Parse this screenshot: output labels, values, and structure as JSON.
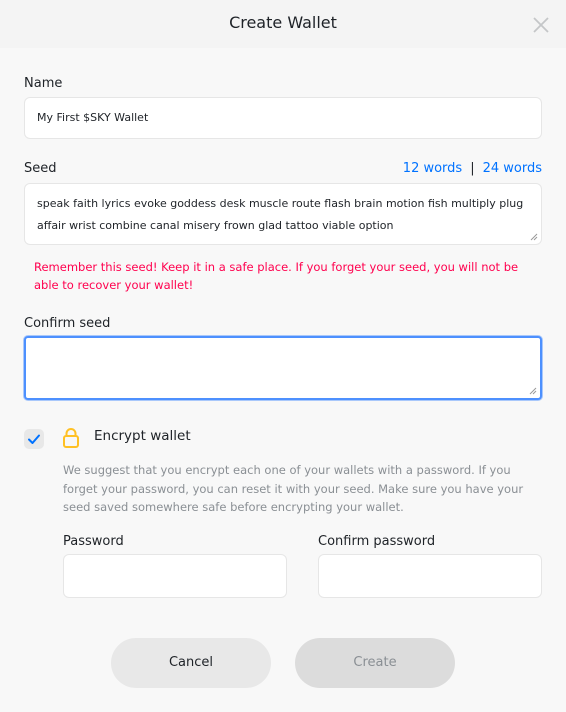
{
  "dialog": {
    "title": "Create Wallet",
    "close_icon": "close-icon"
  },
  "name": {
    "label": "Name",
    "value": "My First $SKY Wallet"
  },
  "seed": {
    "label": "Seed",
    "words_12": "12 words",
    "separator": "|",
    "words_24": "24 words",
    "value": "speak faith lyrics evoke goddess desk muscle route flash brain motion fish multiply plug affair wrist combine canal misery frown glad tattoo viable option",
    "warning": "Remember this seed! Keep it in a safe place. If you forget your seed, you will not be able to recover your wallet!"
  },
  "confirm_seed": {
    "label": "Confirm seed",
    "value": ""
  },
  "encrypt": {
    "checked": true,
    "checkbox_icon": "checkmark-icon",
    "lock_icon": "lock-icon",
    "label": "Encrypt wallet",
    "description": "We suggest that you encrypt each one of your wallets with a password. If you forget your password, you can reset it with your seed. Make sure you have your seed saved somewhere safe before encrypting your wallet.",
    "password_label": "Password",
    "confirm_password_label": "Confirm password"
  },
  "actions": {
    "cancel_label": "Cancel",
    "create_label": "Create"
  },
  "colors": {
    "accent": "#0072ff",
    "warning": "#ff004e",
    "lock": "#ffc125",
    "focus": "#4d90fe"
  }
}
